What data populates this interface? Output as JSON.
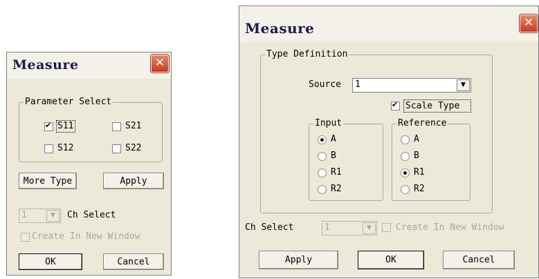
{
  "small": {
    "title": "Measure",
    "group_label": "Parameter Select",
    "params": [
      {
        "label": "S11",
        "checked": true
      },
      {
        "label": "S21",
        "checked": false
      },
      {
        "label": "S12",
        "checked": false
      },
      {
        "label": "S22",
        "checked": false
      }
    ],
    "more_type_label": "More Type",
    "apply_label": "Apply",
    "ch_value": "1",
    "ch_select_label": "Ch Select",
    "create_new_window_label": "Create In New Window",
    "ok_label": "OK",
    "cancel_label": "Cancel"
  },
  "large": {
    "title": "Measure",
    "group_label": "Type Definition",
    "source_label": "Source",
    "source_value": "1",
    "scale_type_label": "Scale Type",
    "scale_type_checked": true,
    "input_group_label": "Input",
    "input_options": [
      "A",
      "B",
      "R1",
      "R2"
    ],
    "input_selected": "A",
    "reference_group_label": "Reference",
    "reference_options": [
      "A",
      "B",
      "R1",
      "R2"
    ],
    "reference_selected": "R1",
    "ch_select_label": "Ch Select",
    "ch_value": "1",
    "create_new_window_label": "Create In New Window",
    "apply_label": "Apply",
    "ok_label": "OK",
    "cancel_label": "Cancel"
  },
  "colors": {
    "dialog_bg": "#ece9d8",
    "close_button": "#c9381b",
    "title_text": "#1a1a50"
  }
}
